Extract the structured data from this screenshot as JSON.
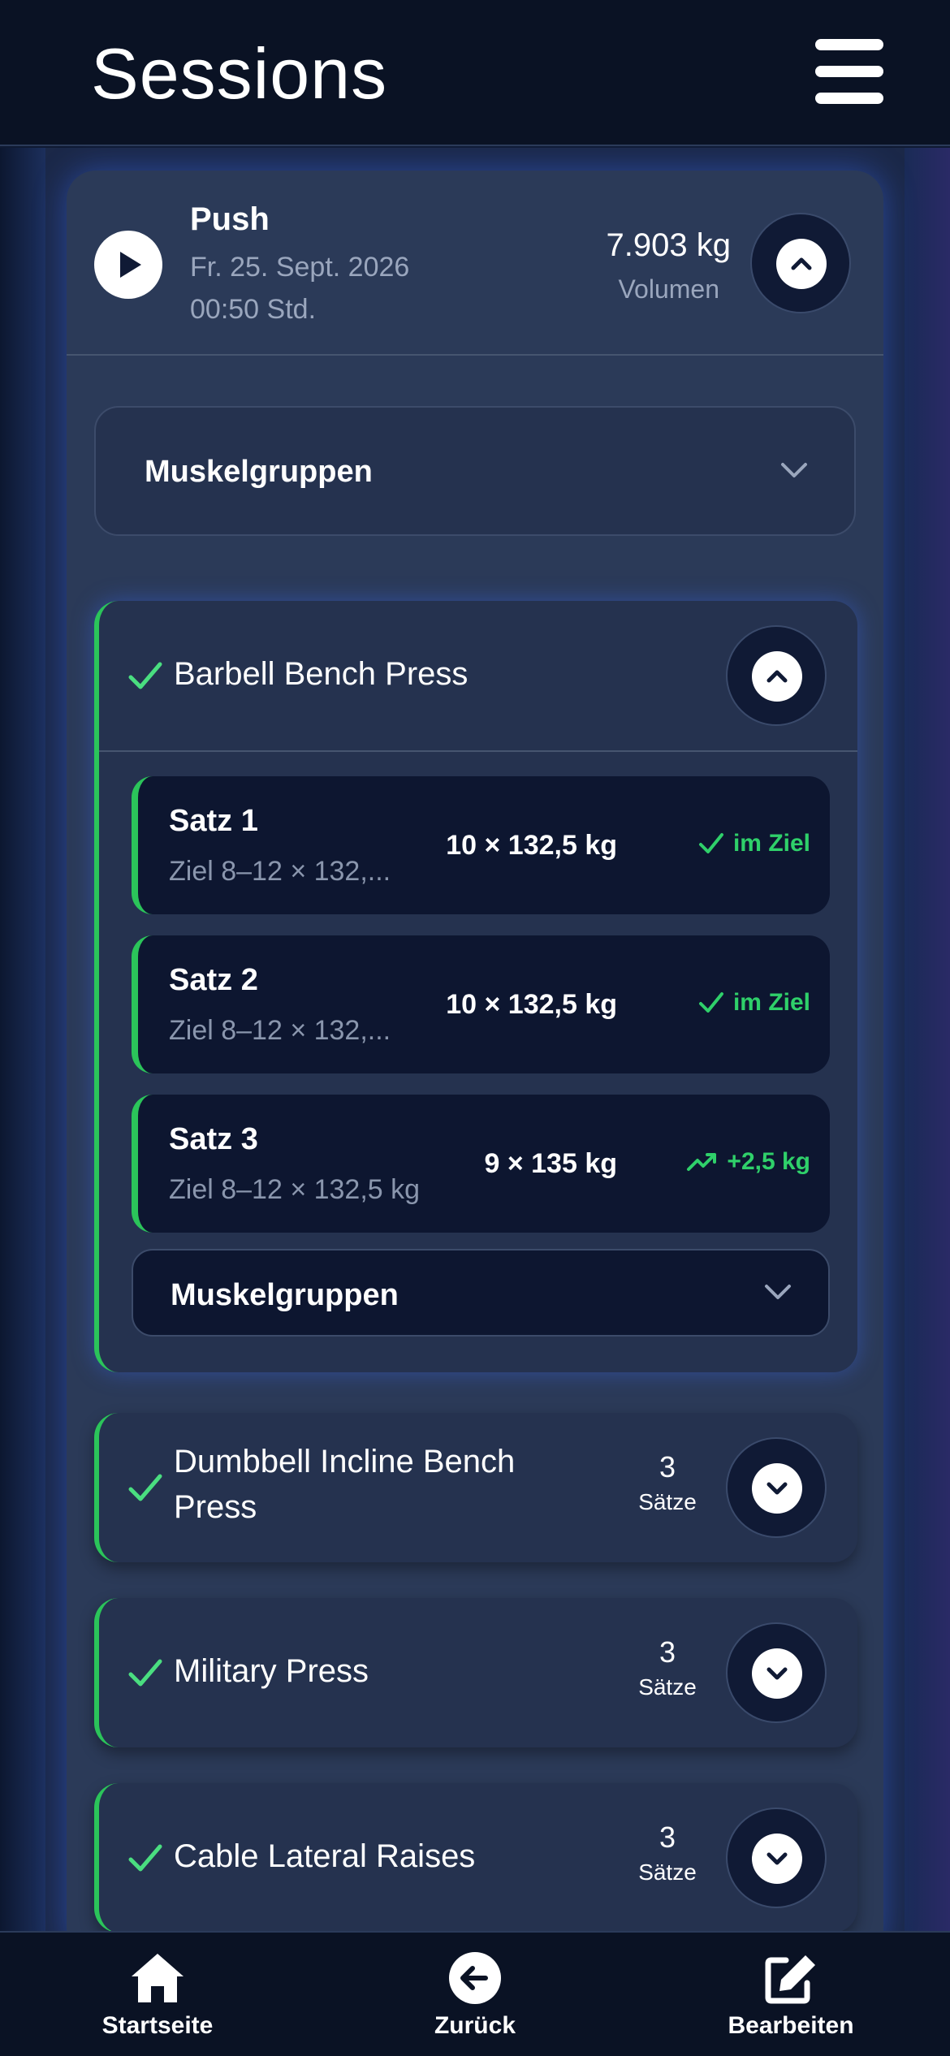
{
  "header": {
    "title": "Sessions",
    "menu_icon": "hamburger-menu-icon"
  },
  "session": {
    "name": "Push",
    "date": "Fr. 25. Sept. 2026",
    "duration": "00:50 Std.",
    "volume": "7.903 kg",
    "volume_label": "Volumen",
    "play_icon": "play-icon",
    "toggle_icon": "chevron-up-icon"
  },
  "muscle_groups_label": "Muskelgruppen",
  "expanded_exercise": {
    "name": "Barbell Bench Press",
    "sets": [
      {
        "name": "Satz 1",
        "goal": "Ziel 8–12 × 132,...",
        "value": "10 × 132,5 kg",
        "status": "im Ziel",
        "status_icon": "check-icon"
      },
      {
        "name": "Satz 2",
        "goal": "Ziel 8–12 × 132,...",
        "value": "10 × 132,5 kg",
        "status": "im Ziel",
        "status_icon": "check-icon"
      },
      {
        "name": "Satz 3",
        "goal": "Ziel 8–12 × 132,5 kg",
        "value": "9 × 135 kg",
        "status": "+2,5 kg",
        "status_icon": "trending-up-icon"
      }
    ],
    "muscle_groups_label": "Muskelgruppen"
  },
  "collapsed_exercises": [
    {
      "name_line1": "Dumbbell Incline Bench",
      "name_line2": "Press",
      "sets": "3",
      "sets_label": "Sätze"
    },
    {
      "name_line1": "Military Press",
      "name_line2": "",
      "sets": "3",
      "sets_label": "Sätze"
    },
    {
      "name_line1": "Cable Lateral Raises",
      "name_line2": "",
      "sets": "3",
      "sets_label": "Sätze"
    }
  ],
  "bottom_nav": {
    "home": "Startseite",
    "back": "Zurück",
    "edit": "Bearbeiten"
  },
  "colors": {
    "accent_green": "#2bc45a",
    "background": "#0f1a33",
    "card": "#2b3a58",
    "set_card": "#0d1630"
  }
}
